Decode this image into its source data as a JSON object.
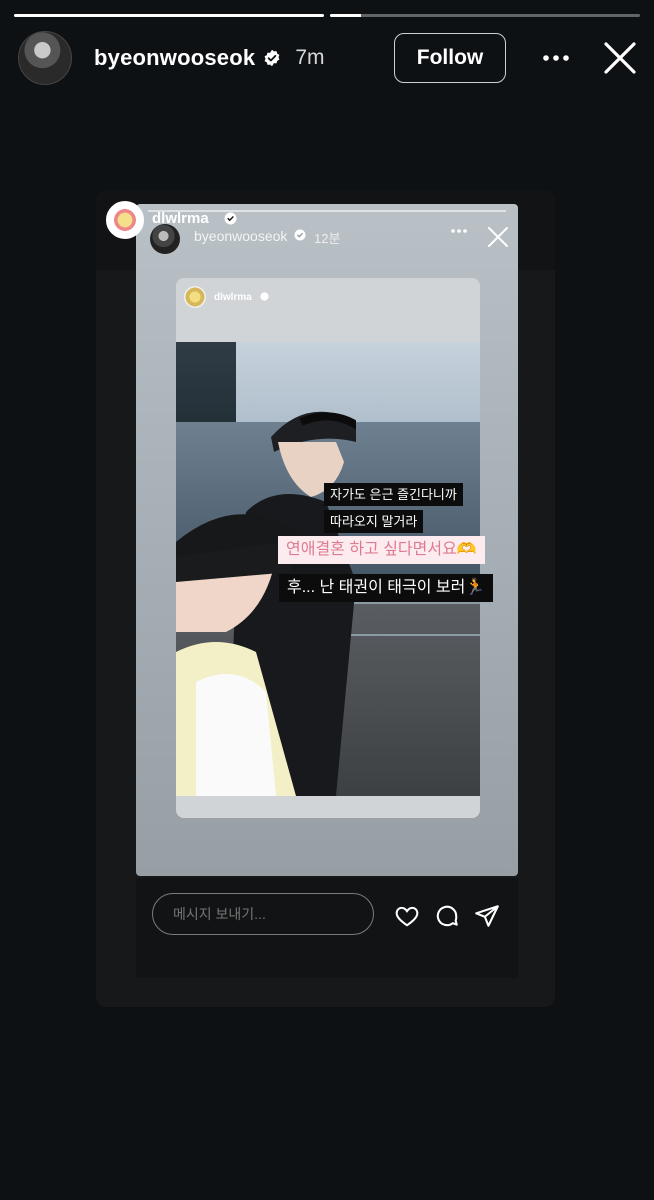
{
  "story": {
    "progress": [
      1.0,
      0.1
    ]
  },
  "header": {
    "username": "byeonwooseok",
    "time": "7m",
    "follow_label": "Follow",
    "icons": [
      "verified-icon",
      "more-icon",
      "close-icon"
    ]
  },
  "shared_story": {
    "username": "dlwlrma",
    "inner": {
      "username": "byeonwooseok",
      "time": "12분",
      "nested": {
        "username": "dlwlrma"
      },
      "captions": [
        "자가도 은근 즐긴다니까",
        "따라오지 말거라",
        "연애결혼 하고 싶다면서요🫶",
        "후... 난 태권이 태극이 보러🏃"
      ]
    }
  },
  "reply": {
    "placeholder": "메시지 보내기...",
    "icons": [
      "heart-icon",
      "comment-icon",
      "send-icon"
    ]
  },
  "colors": {
    "background": "#0e1114",
    "caption_pink_bg": "#fdecef",
    "caption_pink_text": "#e07a90"
  }
}
